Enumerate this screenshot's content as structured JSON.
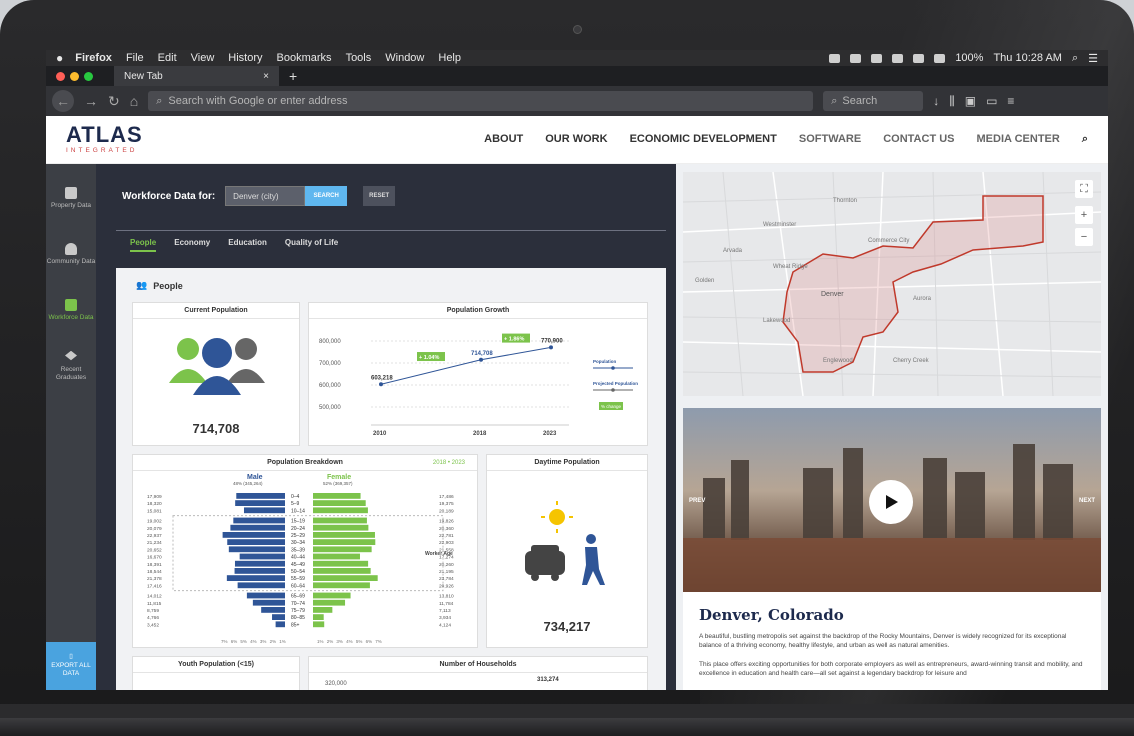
{
  "mac_menu": {
    "apple": "",
    "app": "Firefox",
    "items": [
      "File",
      "Edit",
      "View",
      "History",
      "Bookmarks",
      "Tools",
      "Window",
      "Help"
    ],
    "battery": "100%",
    "clock": "Thu 10:28 AM"
  },
  "browser": {
    "tab_title": "New Tab",
    "url_placeholder": "Search with Google or enter address",
    "search_placeholder": "Search"
  },
  "site": {
    "logo_main": "ATLAS",
    "logo_sub": "INTEGRATED",
    "nav": [
      "ABOUT",
      "OUR WORK",
      "ECONOMIC DEVELOPMENT",
      "SOFTWARE",
      "CONTACT US",
      "MEDIA CENTER"
    ]
  },
  "sidebar": {
    "items": [
      {
        "label": "Property Data"
      },
      {
        "label": "Community Data"
      },
      {
        "label": "Workforce Data"
      },
      {
        "label": "Recent Graduates"
      }
    ],
    "export": "EXPORT ALL DATA"
  },
  "workforce": {
    "label": "Workforce Data for:",
    "input_value": "Denver (city)",
    "search_label": "SEARCH",
    "reset_label": "RESET"
  },
  "tabs": [
    "People",
    "Economy",
    "Education",
    "Quality of Life"
  ],
  "panel_title": "People",
  "current_population": {
    "title": "Current Population",
    "value": "714,708"
  },
  "growth": {
    "title": "Population Growth"
  },
  "breakdown": {
    "title": "Population Breakdown",
    "years": "2018 • 2023",
    "male": "Male",
    "male_sub": "48% (345,264)",
    "female": "Female",
    "female_sub": "52% (369,357)",
    "worker_age": "Worker Age"
  },
  "daytime": {
    "title": "Daytime Population",
    "value": "734,217"
  },
  "youth": {
    "title": "Youth Population (<15)"
  },
  "households": {
    "title": "Number of Households",
    "tick": "320,000",
    "value": "313,274"
  },
  "video": {
    "prev": "PREV",
    "next": "NEXT"
  },
  "city": {
    "title": "Denver, Colorado",
    "p1": "A beautiful, bustling metropolis set against the backdrop of the Rocky Mountains, Denver is widely recognized for its exceptional balance of a thriving economy, healthy lifestyle, and urban as well as natural amenities.",
    "p2": "This place offers exciting opportunities for both corporate employers as well as entrepreneurs, award-winning transit and mobility, and excellence in education and health care—all set against a legendary backdrop for leisure and"
  },
  "map_labels": [
    "Denver",
    "Aurora",
    "Lakewood",
    "Englewood",
    "Westminster",
    "Thornton",
    "Commerce City",
    "Golden",
    "Wheat Ridge",
    "Arvada",
    "Cherry Creek"
  ],
  "chart_data": [
    {
      "type": "line",
      "title": "Population Growth",
      "x": [
        2010,
        2018,
        2023
      ],
      "values": [
        603218,
        714708,
        770900
      ],
      "value_labels": [
        "603,218",
        "714,708",
        "770,900"
      ],
      "change_labels": [
        "+ 1.04%",
        "+ 1.86%"
      ],
      "yticks": [
        "800,000",
        "700,000",
        "600,000",
        "500,000"
      ],
      "ylim": [
        500000,
        800000
      ],
      "legend": [
        "Population",
        "Projected Population",
        "% change"
      ]
    },
    {
      "type": "bar",
      "title": "Population Breakdown",
      "categories": [
        "0–4",
        "5–9",
        "10–14",
        "15–19",
        "20–24",
        "25–29",
        "30–34",
        "35–39",
        "40–44",
        "45–49",
        "50–54",
        "55–59",
        "60–64",
        "65–69",
        "70–74",
        "75–79",
        "80–85",
        "85+"
      ],
      "series": [
        {
          "name": "Male",
          "values": [
            17909,
            18320,
            15081,
            19002,
            20079,
            22937,
            21234,
            20652,
            16670,
            18391,
            18544,
            21378,
            17416,
            14012,
            11815,
            8759,
            4766,
            3452
          ]
        },
        {
          "name": "Female",
          "values": [
            17486,
            19375,
            20189,
            19826,
            20360,
            22781,
            22903,
            21558,
            17274,
            20260,
            21195,
            23784,
            20926,
            13810,
            11784,
            7113,
            3934,
            4124
          ]
        }
      ],
      "male_labels": [
        "17,909",
        "18,320",
        "15,081",
        "19,002",
        "20,079",
        "22,937",
        "21,234",
        "20,652",
        "16,670",
        "18,391",
        "18,544",
        "21,378",
        "17,416",
        "14,012",
        "11,815",
        "8,759",
        "4,766",
        "3,452"
      ],
      "female_labels": [
        "17,486",
        "19,375",
        "20,189",
        "19,826",
        "20,360",
        "22,781",
        "22,903",
        "21,558",
        "17,274",
        "20,260",
        "21,195",
        "23,784",
        "20,926",
        "13,810",
        "11,784",
        "7,113",
        "3,934",
        "4,124"
      ],
      "axis_ticks": [
        "7%",
        "6%",
        "5%",
        "4%",
        "3%",
        "2%",
        "1%",
        "1%",
        "2%",
        "3%",
        "4%",
        "5%",
        "6%",
        "7%"
      ]
    }
  ]
}
